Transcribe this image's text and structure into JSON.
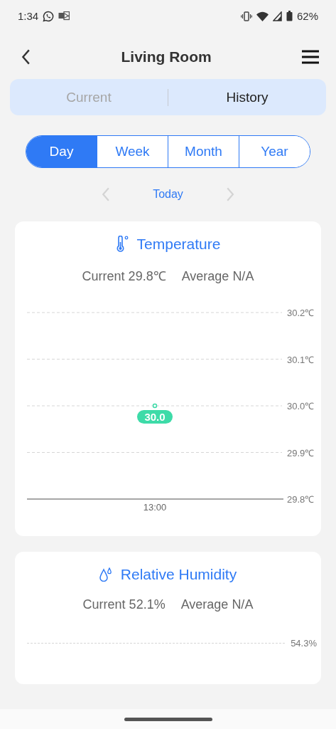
{
  "status_bar": {
    "time": "1:34",
    "battery": "62%"
  },
  "header": {
    "title": "Living Room"
  },
  "view_tabs": [
    {
      "label": "Current",
      "selected": false
    },
    {
      "label": "History",
      "selected": true
    }
  ],
  "periods": [
    {
      "label": "Day",
      "selected": true
    },
    {
      "label": "Week",
      "selected": false
    },
    {
      "label": "Month",
      "selected": false
    },
    {
      "label": "Year",
      "selected": false
    }
  ],
  "date_nav": {
    "label": "Today",
    "prev_disabled": true,
    "next_disabled": true
  },
  "temperature": {
    "title": "Temperature",
    "current": "Current 29.8℃",
    "average": "Average N/A",
    "chart_data": {
      "type": "scatter",
      "categories": [
        "13:00"
      ],
      "series": [
        {
          "color": "#3ddba8",
          "values": [
            30.0
          ]
        }
      ],
      "grid": true,
      "ylim": [
        29.8,
        30.2
      ],
      "yticks": [
        {
          "value": 30.2,
          "label": "30.2℃"
        },
        {
          "value": 30.1,
          "label": "30.1℃"
        },
        {
          "value": 30.0,
          "label": "30.0℃"
        },
        {
          "value": 29.9,
          "label": "29.9℃"
        },
        {
          "value": 29.8,
          "label": "29.8℃"
        }
      ],
      "value_labels": [
        "30.0"
      ]
    }
  },
  "humidity": {
    "title": "Relative Humidity",
    "current": "Current 52.1%",
    "average": "Average N/A",
    "axis_label": "54.3%"
  }
}
